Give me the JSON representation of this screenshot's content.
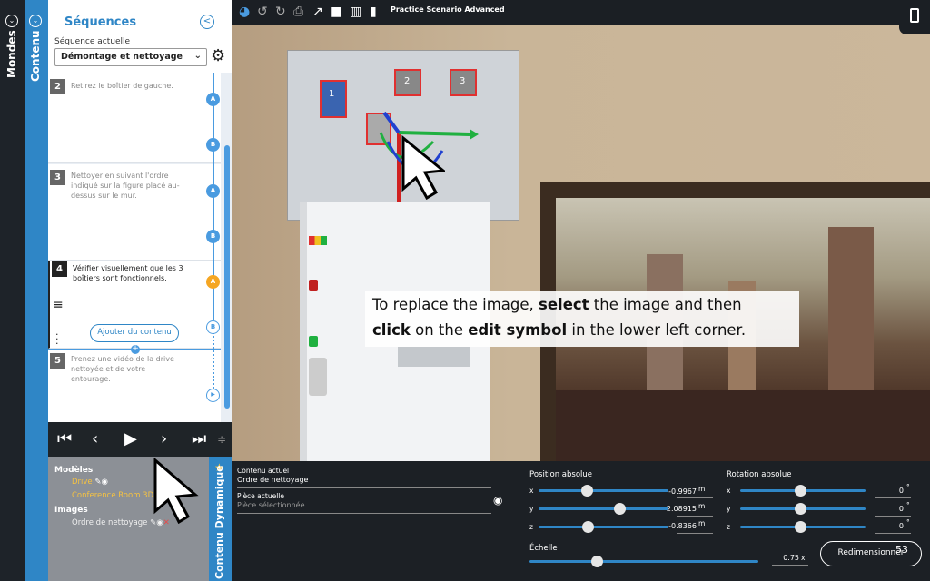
{
  "rails": {
    "mondes": "Mondes",
    "contenu": "Contenu"
  },
  "sequences": {
    "title": "Séquences",
    "current_label": "Séquence actuelle",
    "current_value": "Démontage et nettoyage",
    "steps": [
      {
        "num": "2",
        "text": "Retirez le boîtier de gauche."
      },
      {
        "num": "3",
        "text": "Nettoyer en suivant l'ordre indiqué sur la figure placé au-dessus sur le mur."
      },
      {
        "num": "4",
        "text": "Vérifier visuellement que les 3 boîtiers sont fonctionnels."
      },
      {
        "num": "5",
        "text": "Prenez une vidéo de la drive nettoyée et de votre entourage."
      }
    ],
    "nodes": [
      "A",
      "B",
      "A",
      "B",
      "A",
      "B"
    ],
    "add_content": "Ajouter du contenu"
  },
  "dynamic": {
    "side_title": "Contenu Dynamique",
    "models_label": "Modèles",
    "models": [
      "Drive",
      "Conference Room 3D"
    ],
    "images_label": "Images",
    "images": [
      "Ordre de nettoyage"
    ]
  },
  "toolbar": {
    "scenario_title": "Practice Scenario Advanced"
  },
  "tooltip": {
    "t1": "To replace the image, ",
    "b1": "select",
    "t2": " the image and then",
    "b2": "click",
    "t3": " on the ",
    "b3": "edit symbol",
    "t4": " in the lower left corner."
  },
  "cabinet_labels": [
    "1",
    "2",
    "3"
  ],
  "properties": {
    "current_content_label": "Contenu actuel",
    "current_content_value": "Ordre de nettoyage",
    "current_piece_label": "Pièce actuelle",
    "current_piece_placeholder": "Pièce sélectionnée",
    "position_label": "Position absolue",
    "rotation_label": "Rotation absolue",
    "scale_label": "Échelle",
    "position": {
      "x": "-0.9967",
      "y": "2.08915",
      "z": "-0.8366",
      "unit": "m"
    },
    "rotation": {
      "x": "0",
      "y": "0",
      "z": "0",
      "unit": "°"
    },
    "scale": {
      "value": "0.75",
      "unit": "x"
    },
    "resize_button": "Redimensionner",
    "page_number": "53"
  },
  "colors": {
    "accent": "#2f86c6",
    "highlight": "#f5c242",
    "orange": "#f5a623"
  }
}
